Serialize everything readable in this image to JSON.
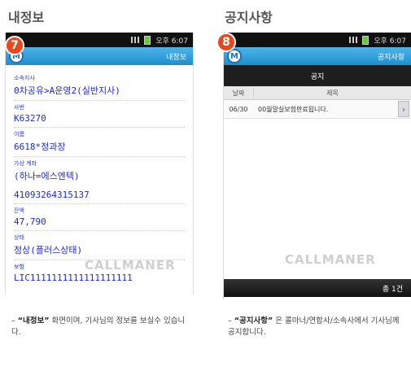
{
  "left": {
    "section_title": "내정보",
    "badge": "7",
    "status_time": "오후 6:07",
    "app_logo": "M",
    "app_title": "내정보",
    "fields": [
      {
        "label": "소속지사",
        "value": "0차공유>A운영2(실반지사)"
      },
      {
        "label": "사번",
        "value": "K63270"
      },
      {
        "label": "이름",
        "value": "6618*정과장"
      },
      {
        "label": "가상 계좌",
        "value": "(하나=에스엔텍)"
      },
      {
        "label": "",
        "value": "41093264315137"
      },
      {
        "label": "잔액",
        "value": "47,790"
      },
      {
        "label": "상태",
        "value": "정상(플러스상태)"
      },
      {
        "label": "보험",
        "value": "LIC1111111111111111111"
      }
    ],
    "watermark": "CALLMANER",
    "caption_title": "“내정보”",
    "caption_text": "화면이며, 기사님의 정보를 보실수 있습니다."
  },
  "right": {
    "section_title": "공지사항",
    "badge": "8",
    "status_time": "오후 6:07",
    "app_logo": "M",
    "app_title": "공지사항",
    "tab_title": "공지",
    "col_date": "날짜",
    "col_title": "제목",
    "rows": [
      {
        "date": "06/30",
        "title": "00월말실보험판료됩니다."
      }
    ],
    "footer": "총 1건",
    "watermark": "CALLMANER",
    "caption_title": "“공지사항”",
    "caption_text": "은 콜마너/연합사/소속사에서 기사님께 공지합니다."
  }
}
